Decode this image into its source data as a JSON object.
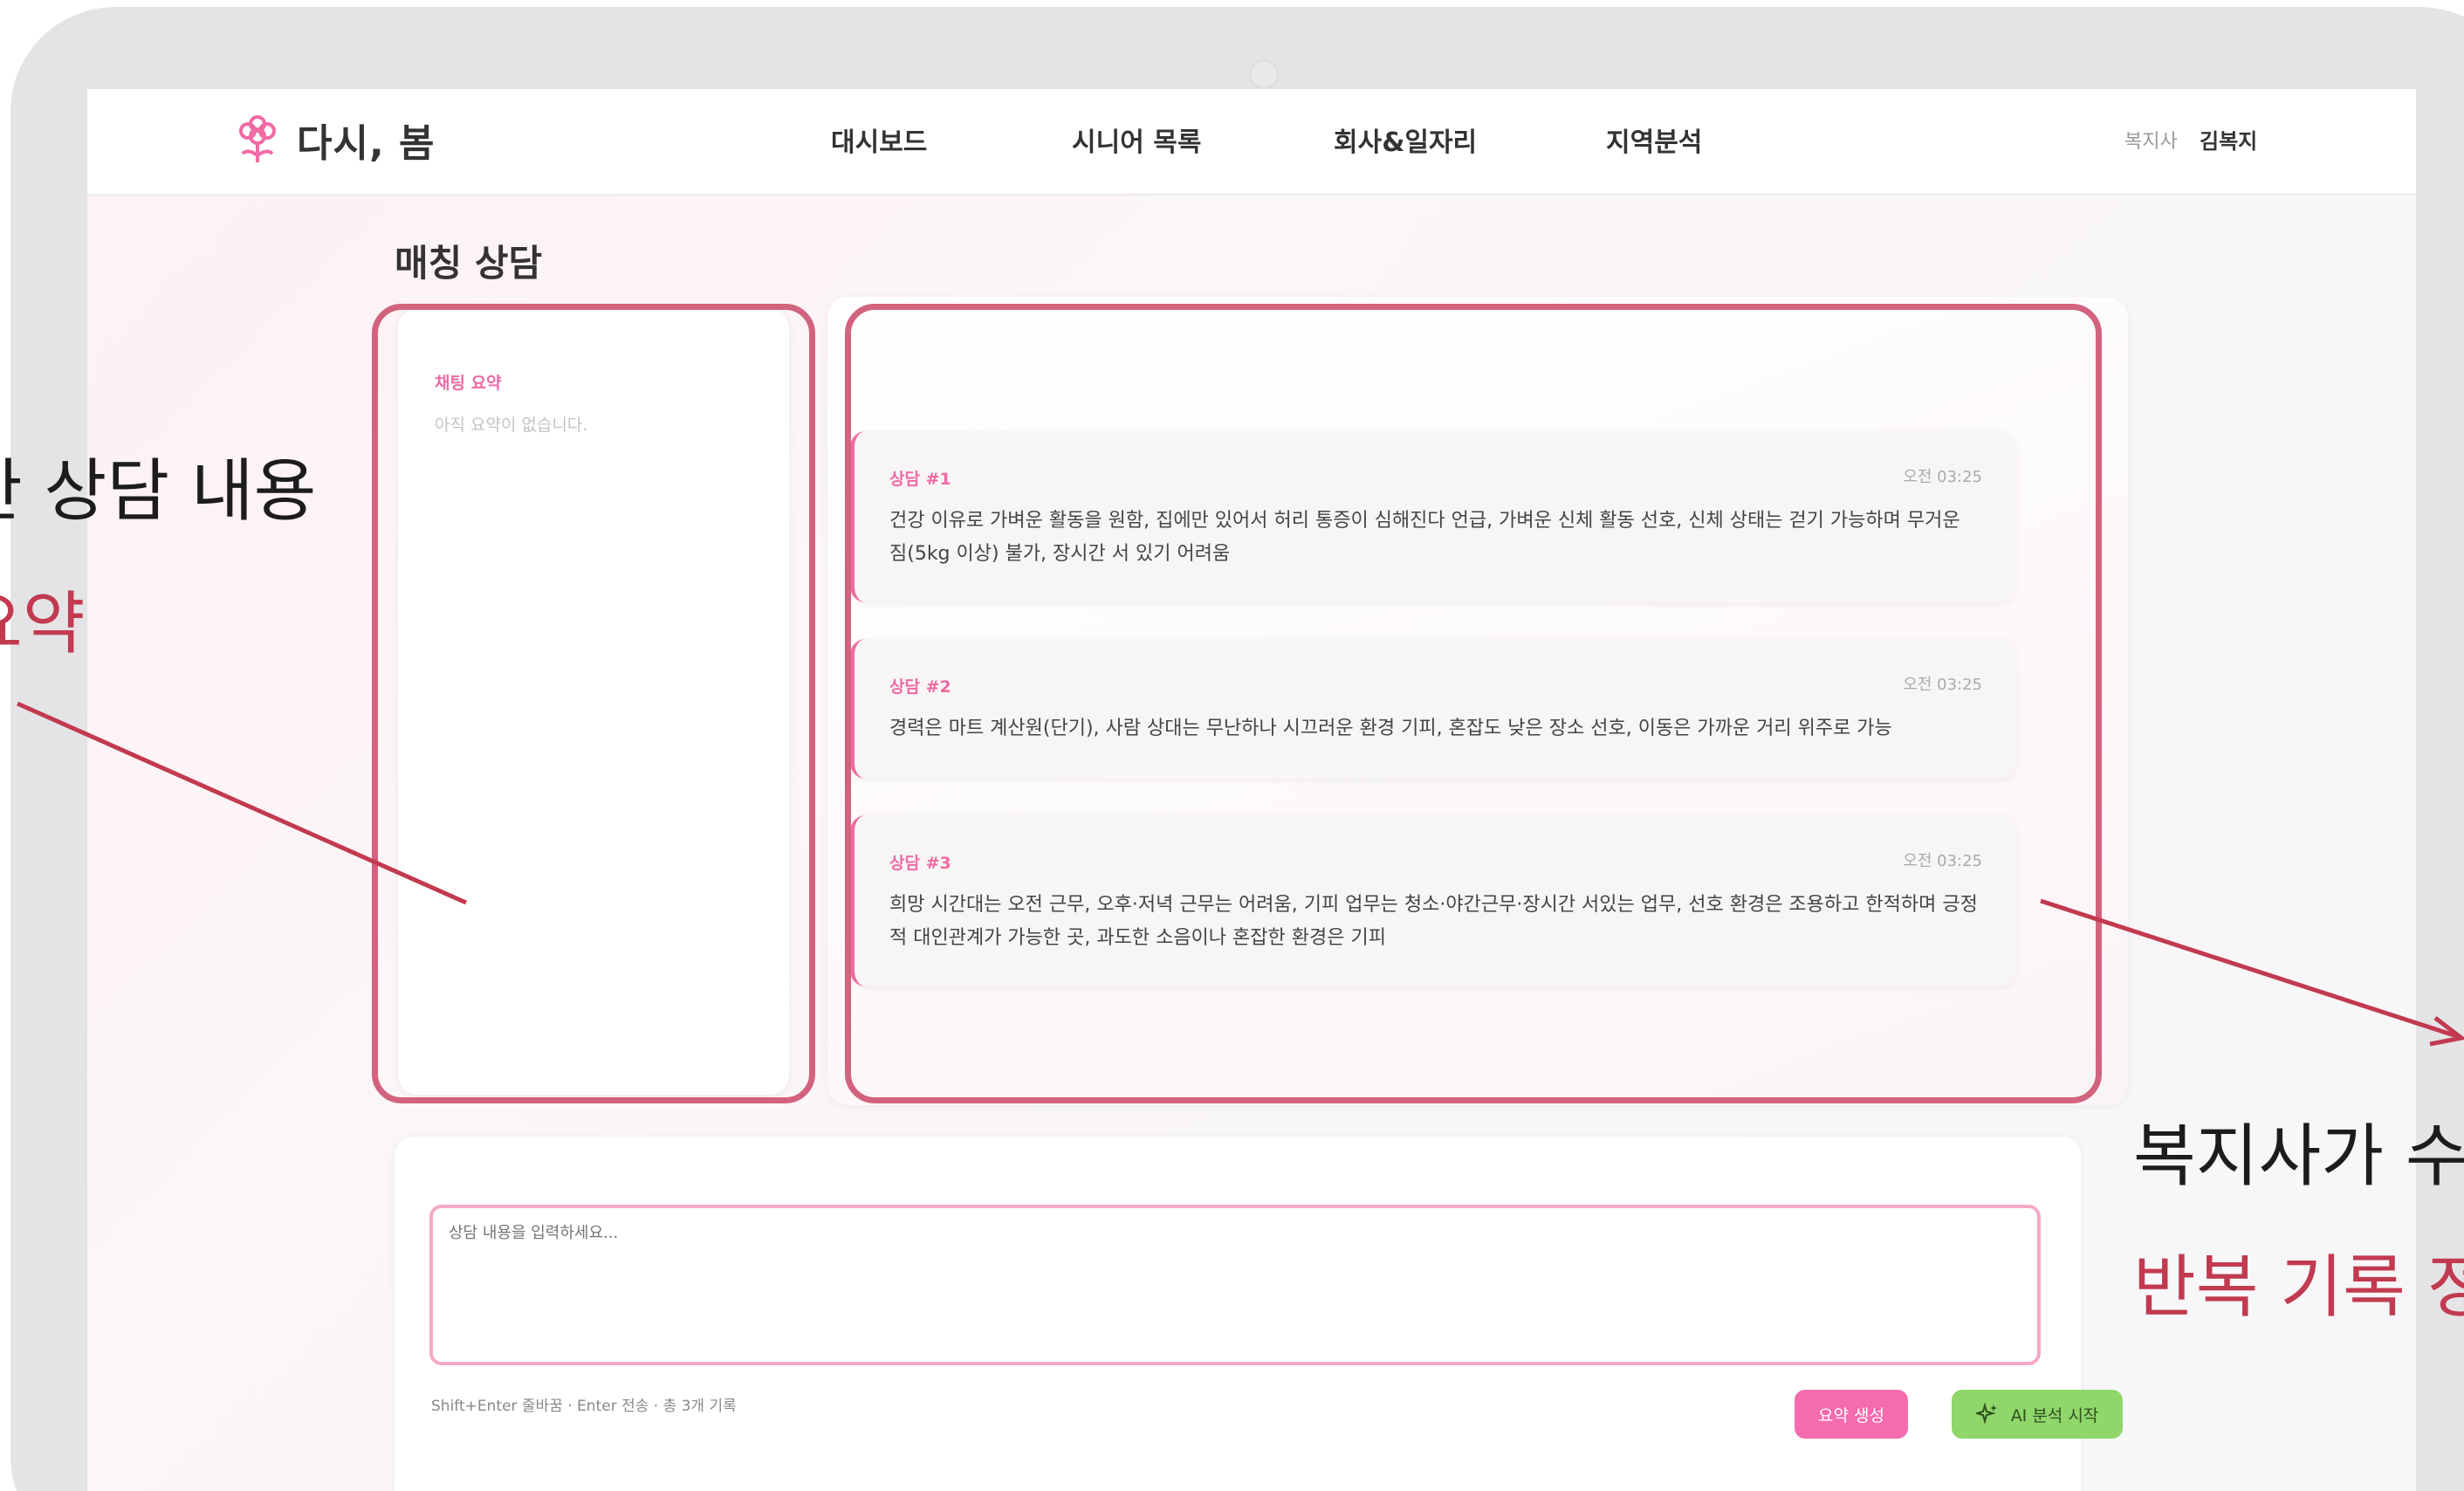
{
  "app": {
    "logo_text": "다시, 봄"
  },
  "nav": {
    "items": [
      "대시보드",
      "시니어 목록",
      "회사&일자리",
      "지역분석"
    ],
    "user_role": "복지사",
    "user_name": "김복지"
  },
  "page": {
    "title": "매칭 상담"
  },
  "summary": {
    "title": "채팅 요약",
    "empty_text": "아직 요약이 없습니다."
  },
  "notes": [
    {
      "label": "상담 #1",
      "time": "오전 03:25",
      "text": "건강 이유로 가벼운 활동을 원함, 집에만 있어서 허리 통증이 심해진다 언급, 가벼운 신체 활동 선호, 신체 상태는 걷기 가능하며 무거운 짐(5kg 이상) 불가, 장시간 서 있기 어려움"
    },
    {
      "label": "상담 #2",
      "time": "오전 03:25",
      "text": "경력은 마트 계산원(단기), 사람 상대는 무난하나 시끄러운 환경 기피, 혼잡도 낮은 장소 선호, 이동은 가까운 거리 위주로 가능"
    },
    {
      "label": "상담 #3",
      "time": "오전 03:25",
      "text": "희망 시간대는 오전 근무, 오후·저녁 근무는 어려움, 기피 업무는 청소·야간근무·장시간 서있는 업무, 선호 환경은 조용하고 한적하며 긍정적 대인관계가 가능한 곳, 과도한 소음이나 혼잡한 환경은 기피"
    }
  ],
  "input": {
    "placeholder": "상담 내용을 입력하세요...",
    "hint": "Shift+Enter 줄바꿈 · Enter 전송 · 총 3개 기록",
    "summary_button": "요약 생성",
    "ai_button": "AI 분석 시작"
  },
  "annotations": {
    "left_line1": "한 상담 내용",
    "left_line2": "요약",
    "right_line1": "복지사가 수",
    "right_line2": "반복 기록 정"
  },
  "colors": {
    "accent_pink": "#f06aa4",
    "highlight": "#d2637e",
    "annotation_red": "#c23a50",
    "ai_button_green": "#8fd66b"
  }
}
